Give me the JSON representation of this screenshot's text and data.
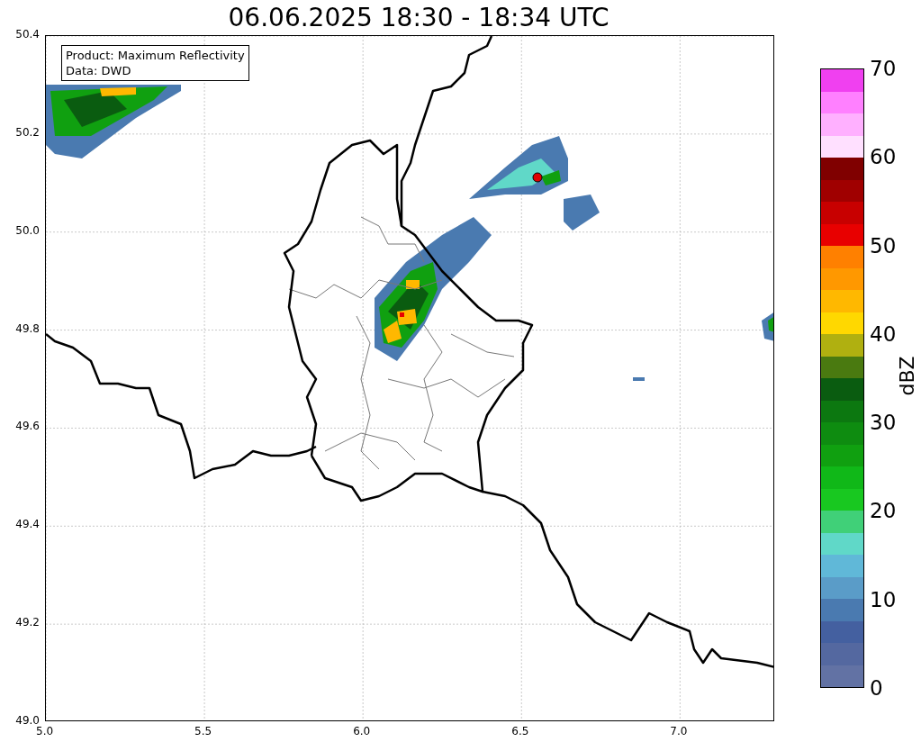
{
  "title": "06.06.2025 18:30 - 18:34 UTC",
  "legend": [
    "Product: Maximum Reflectivity",
    "Data: DWD"
  ],
  "map": {
    "xticks": [
      "5.0",
      "5.5",
      "6.0",
      "6.5",
      "7.0"
    ],
    "yticks": [
      "50.4",
      "50.2",
      "50.0",
      "49.8",
      "49.6",
      "49.4",
      "49.2",
      "49.0"
    ]
  },
  "colorbar": {
    "label": "dBZ",
    "ticks": [
      "70",
      "60",
      "50",
      "40",
      "30",
      "20",
      "10",
      "0"
    ],
    "segments": [
      {
        "color": "#6272a4"
      },
      {
        "color": "#5468a0"
      },
      {
        "color": "#4460a0"
      },
      {
        "color": "#4a7ab0"
      },
      {
        "color": "#5a9cc8"
      },
      {
        "color": "#60b8d8"
      },
      {
        "color": "#60d8c8"
      },
      {
        "color": "#40d078"
      },
      {
        "color": "#18c820"
      },
      {
        "color": "#10b818"
      },
      {
        "color": "#10a010"
      },
      {
        "color": "#0e8c10"
      },
      {
        "color": "#0c7810"
      },
      {
        "color": "#0a5c10"
      },
      {
        "color": "#4a7a10"
      },
      {
        "color": "#b0b010"
      },
      {
        "color": "#ffd800"
      },
      {
        "color": "#ffb800"
      },
      {
        "color": "#ff9800"
      },
      {
        "color": "#ff8000"
      },
      {
        "color": "#e80000"
      },
      {
        "color": "#c80000"
      },
      {
        "color": "#a00000"
      },
      {
        "color": "#800000"
      },
      {
        "color": "#ffe0ff"
      },
      {
        "color": "#ffb0ff"
      },
      {
        "color": "#ff80ff"
      },
      {
        "color": "#f040f0"
      }
    ]
  }
}
